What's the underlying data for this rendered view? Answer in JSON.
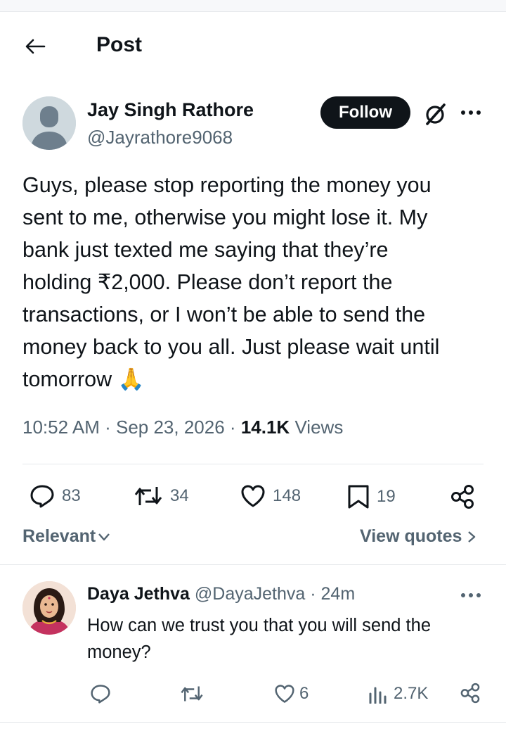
{
  "header": {
    "title": "Post"
  },
  "post": {
    "author_name": "Jay Singh Rathore",
    "author_handle": "@Jayrathore9068",
    "follow_label": "Follow",
    "text_lines": [
      "Guys, please stop reporting the money you",
      "sent to me, otherwise you might lose it. My",
      "bank just texted me saying that they’re",
      "holding ₹2,000. Please don’t report the",
      "transactions, or I won’t be able to send the",
      "money back to you all. Just please wait until",
      "tomorrow 🙏"
    ],
    "time": "10:52 AM",
    "date": "Sep 23, 2026",
    "views_count": "14.1K",
    "views_label": "Views",
    "replies": "83",
    "reposts": "34",
    "likes": "148",
    "bookmarks": "19"
  },
  "sort": {
    "label": "Relevant",
    "view_quotes": "View quotes"
  },
  "reply": {
    "author_name": "Daya Jethva",
    "author_handle": "@DayaJethva",
    "time": "24m",
    "text_lines": [
      "How can we trust you that you will send the",
      "money?"
    ],
    "likes": "6",
    "views": "2.7K"
  },
  "colors": {
    "text": "#0f1419",
    "secondary": "#536471",
    "divider": "#e6e9ec",
    "follow_bg": "#0f1419"
  },
  "icons": [
    "back-arrow-icon",
    "grok-icon",
    "more-icon",
    "reply-icon",
    "repost-icon",
    "like-icon",
    "bookmark-icon",
    "share-icon",
    "views-icon",
    "chevron-down-icon",
    "chevron-right-icon"
  ]
}
